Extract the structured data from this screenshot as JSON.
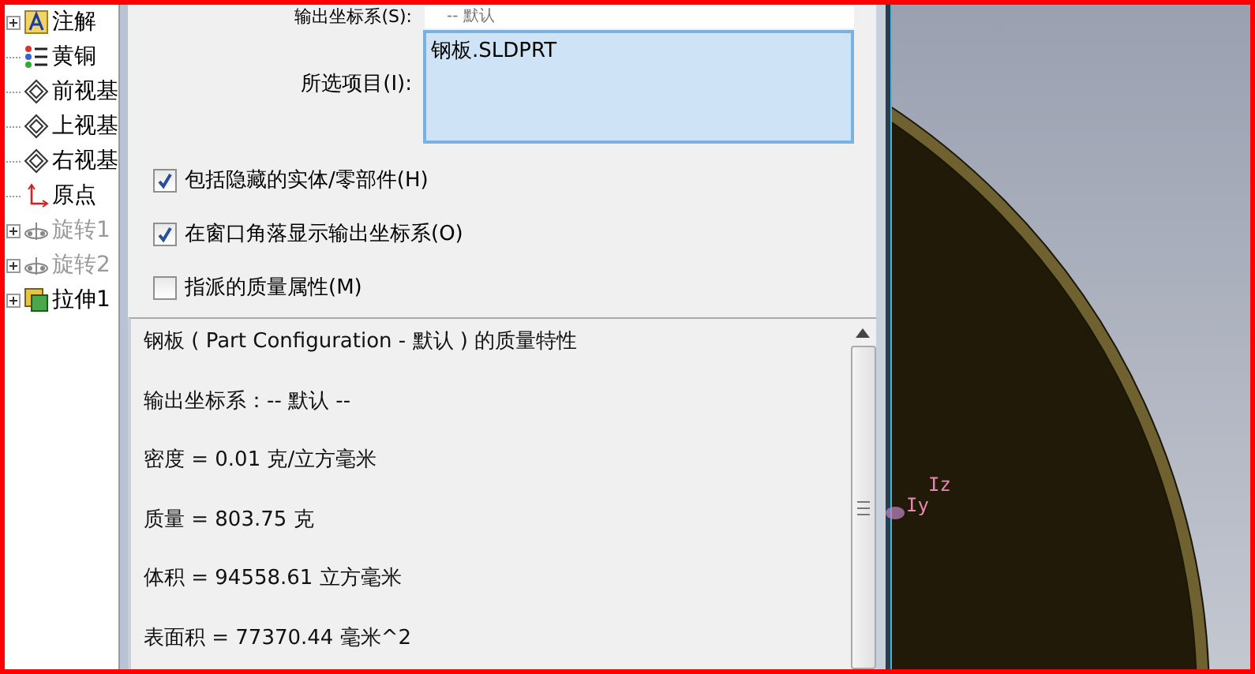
{
  "tree": {
    "items": [
      {
        "label": "注解",
        "kind": "annotation",
        "expandable": true,
        "disabled": false
      },
      {
        "label": "黄铜",
        "kind": "material",
        "expandable": false,
        "disabled": false
      },
      {
        "label": "前视基",
        "kind": "plane",
        "expandable": false,
        "disabled": false
      },
      {
        "label": "上视基",
        "kind": "plane",
        "expandable": false,
        "disabled": false
      },
      {
        "label": "右视基",
        "kind": "plane",
        "expandable": false,
        "disabled": false
      },
      {
        "label": "原点",
        "kind": "origin",
        "expandable": false,
        "disabled": false
      },
      {
        "label": "旋转1",
        "kind": "revolve",
        "expandable": true,
        "disabled": true
      },
      {
        "label": "旋转2",
        "kind": "revolve",
        "expandable": true,
        "disabled": true
      },
      {
        "label": "拉伸1",
        "kind": "extrude",
        "expandable": true,
        "disabled": false
      }
    ]
  },
  "dialog": {
    "coordinate_system": {
      "label": "输出坐标系(S):",
      "value": "-- 默认"
    },
    "selected_items": {
      "label": "所选项目(I):",
      "items": [
        "钢板.SLDPRT"
      ]
    },
    "options": [
      {
        "label": "包括隐藏的实体/零部件(H)",
        "checked": true
      },
      {
        "label": "在窗口角落显示输出坐标系(O)",
        "checked": true
      },
      {
        "label": "指派的质量属性(M)",
        "checked": false
      }
    ],
    "results": [
      "钢板 ( Part Configuration - 默认 ) 的质量特性",
      "输出坐标系：-- 默认 --",
      "密度 = 0.01 克/立方毫米",
      "质量 = 803.75 克",
      "体积 = 94558.61 立方毫米",
      "表面积 = 77370.44 毫米^2"
    ]
  },
  "viewport": {
    "axis_labels": [
      "Iz",
      "Iy"
    ]
  }
}
